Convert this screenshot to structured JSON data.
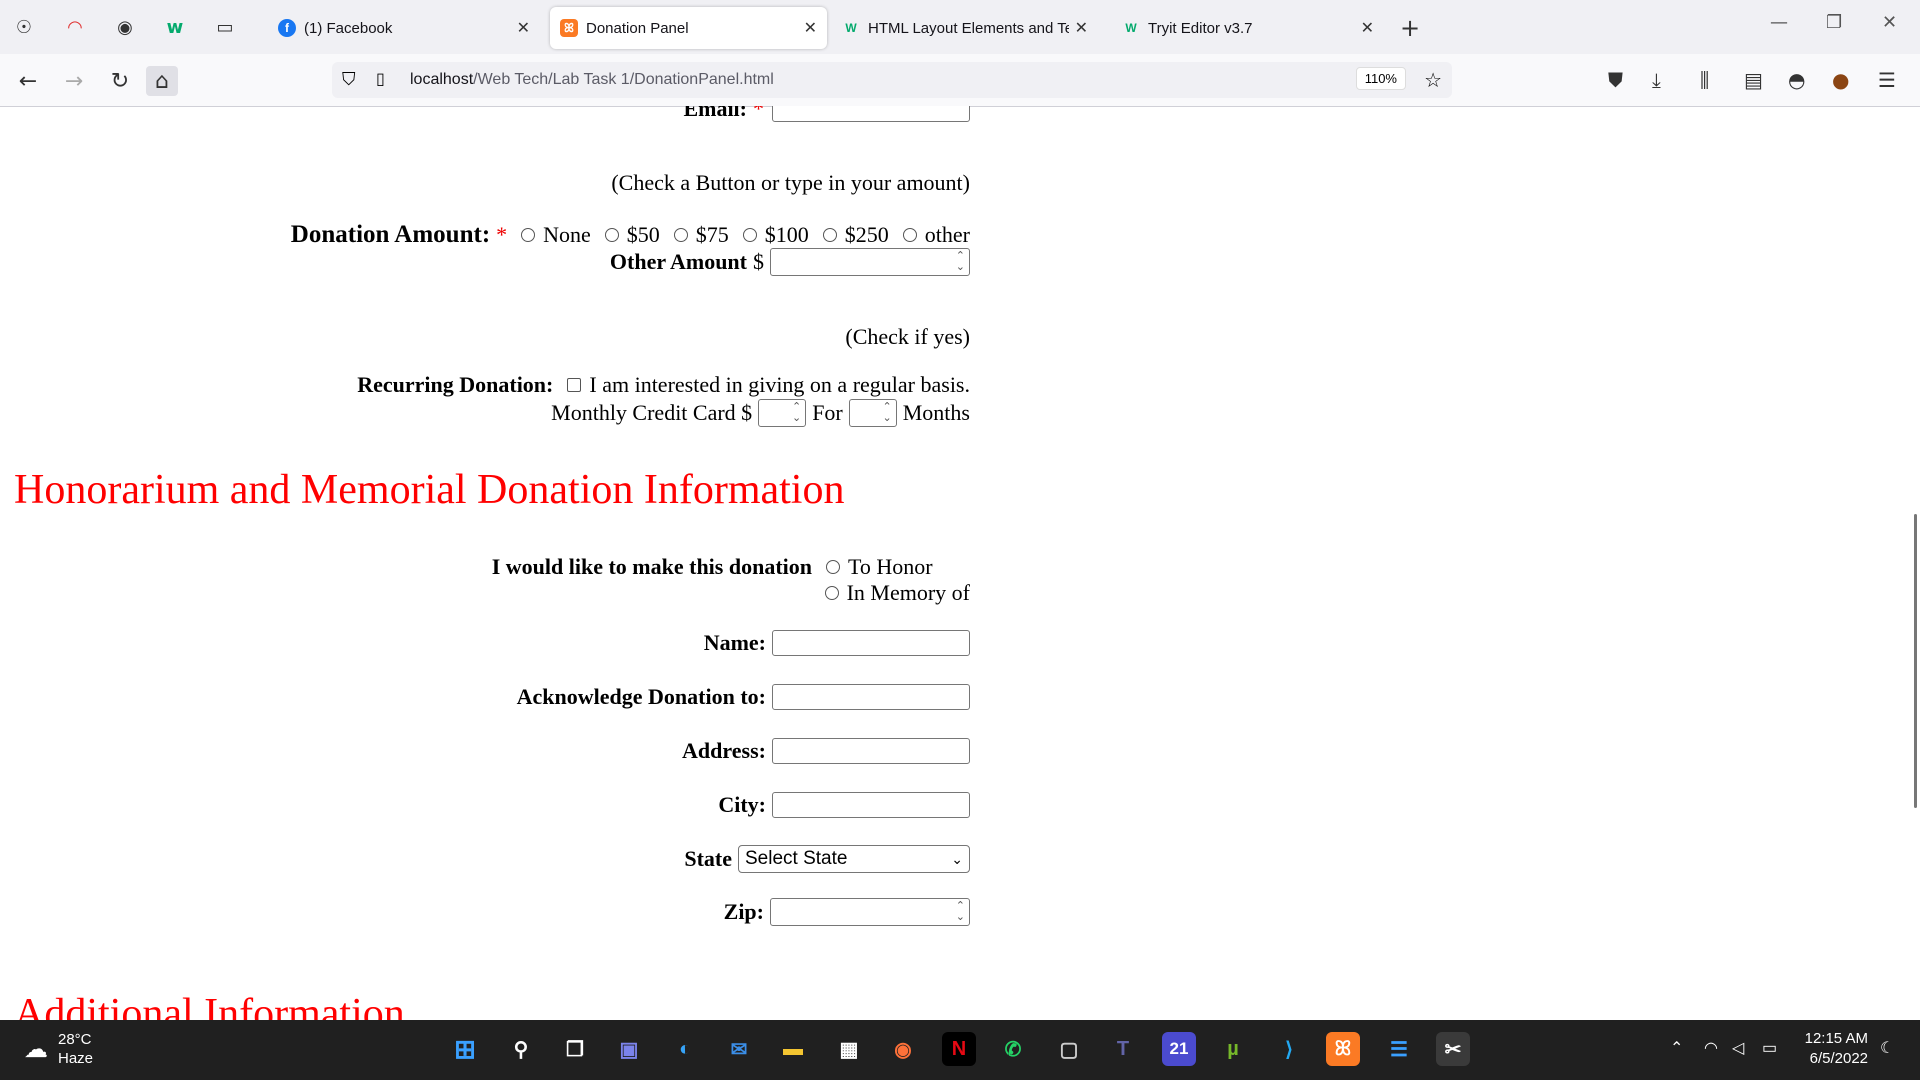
{
  "browser": {
    "tabs": [
      {
        "label": "(1) Facebook",
        "icon": "facebook-icon"
      },
      {
        "label": "Donation Panel",
        "icon": "xampp-icon",
        "active": true
      },
      {
        "label": "HTML Layout Elements and Tec",
        "icon": "w3schools-icon"
      },
      {
        "label": "Tryit Editor v3.7",
        "icon": "w3schools-icon"
      }
    ],
    "url_host": "localhost",
    "url_path": "/Web Tech/Lab Task 1/DonationPanel.html",
    "zoom": "110%"
  },
  "form": {
    "email_label": "Email:",
    "required_mark": "*",
    "amount_hint": "(Check a Button or type in your amount)",
    "amount_label": "Donation Amount:",
    "amount_options": [
      "None",
      "$50",
      "$75",
      "$100",
      "$250",
      "other"
    ],
    "other_amount_label": "Other Amount",
    "dollar_sign": "$",
    "recurring_hint": "(Check if yes)",
    "recurring_label": "Recurring Donation:",
    "recurring_text": "I am interested in giving on a regular basis.",
    "monthly_label": "Monthly Credit Card $",
    "for_label": "For",
    "months_label": "Months"
  },
  "honorarium": {
    "heading": "Honorarium and Memorial Donation Information",
    "donation_label": "I would like to make this donation",
    "option_honor": "To Honor",
    "option_memory": "In Memory of",
    "name_label": "Name:",
    "acknowledge_label": "Acknowledge Donation to:",
    "address_label": "Address:",
    "city_label": "City:",
    "state_label": "State",
    "state_value": "Select State",
    "zip_label": "Zip:"
  },
  "additional": {
    "heading": "Additional Information"
  },
  "taskbar": {
    "temperature": "28°C",
    "weather": "Haze",
    "time": "12:15 AM",
    "date": "6/5/2022",
    "badge_21": "21"
  }
}
